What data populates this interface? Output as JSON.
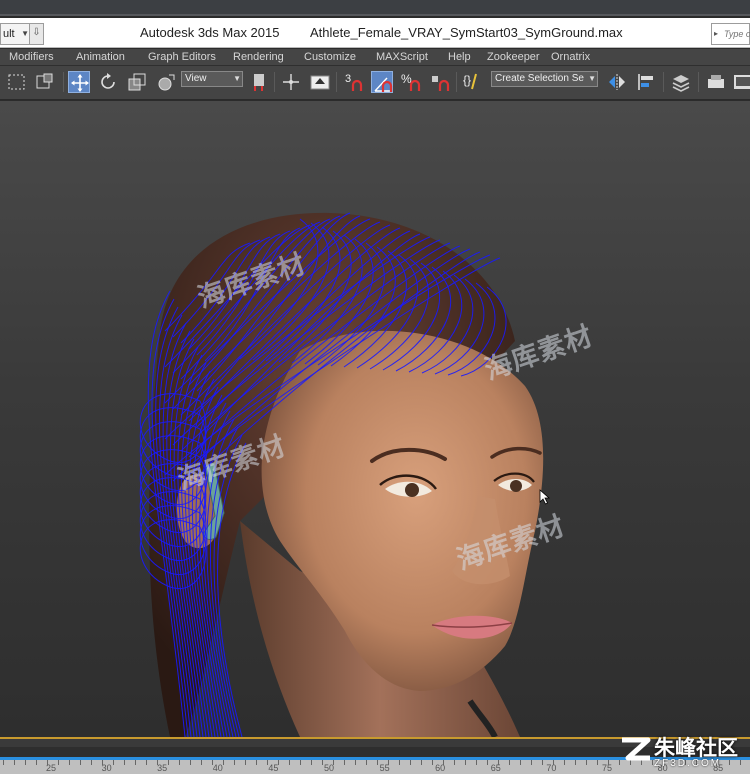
{
  "window": {
    "workspace_combo": "ult",
    "app_title": "Autodesk 3ds Max  2015",
    "file_name": "Athlete_Female_VRAY_SymStart03_SymGround.max",
    "search_placeholder": "Type o"
  },
  "menu": [
    "Modifiers",
    "Animation",
    "Graph Editors",
    "Rendering",
    "Customize",
    "MAXScript",
    "Help",
    "Zookeeper",
    "Ornatrix"
  ],
  "toolbar": {
    "ref_coord": "View",
    "selection_set": "Create Selection Se",
    "snap_label": "3",
    "percent_label": "%",
    "active_tool": "select-and-move"
  },
  "viewport": {
    "watermarks": [
      "海库素材",
      "海库素材",
      "海库素材",
      "海库素材"
    ],
    "hair_guide_color": "#1a1aff"
  },
  "timeline": {
    "ticks": [
      "25",
      "30",
      "35",
      "40",
      "45",
      "50",
      "55",
      "60",
      "65",
      "70",
      "75",
      "80",
      "85"
    ]
  },
  "logo": {
    "name": "朱峰社区",
    "url": "ZF3D.COM"
  },
  "colors": {
    "selection_blue": "#5d86c5",
    "timeline_blue": "#2a8fe0"
  }
}
